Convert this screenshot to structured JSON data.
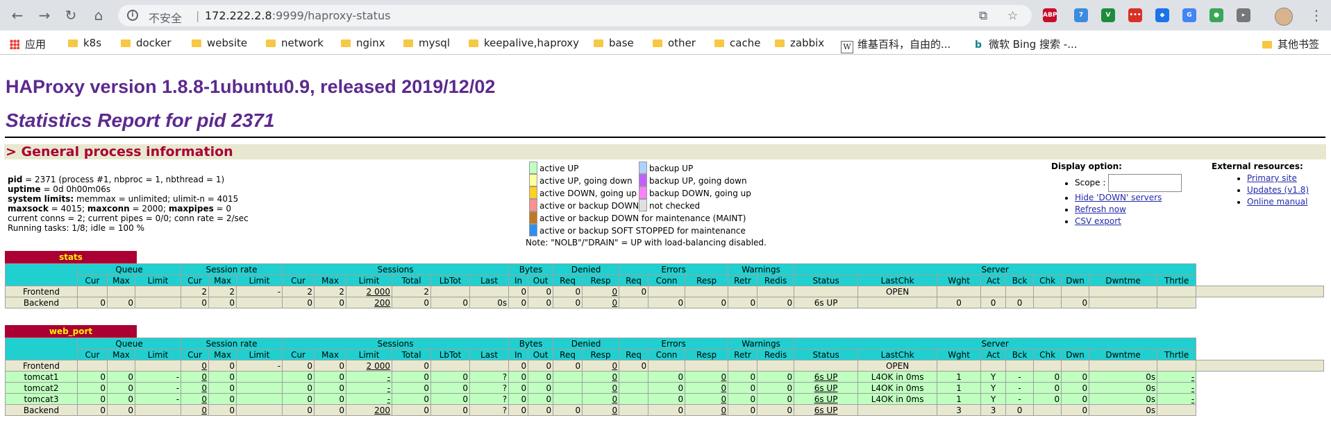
{
  "browser": {
    "insecure_label": "不安全",
    "url_host": "172.222.2.8",
    "url_rest": ":9999/haproxy-status",
    "bookmarks": [
      "应用",
      "k8s",
      "docker",
      "website",
      "network",
      "nginx",
      "mysql",
      "keepalive,haproxy",
      "base",
      "other",
      "cache",
      "zabbix",
      "维基百科，自由的...",
      "微软 Bing 搜索 -...",
      "其他书签"
    ],
    "extensions": [
      {
        "name": "abp-icon",
        "label": "ABP",
        "color": "#c70d2c"
      },
      {
        "name": "puzzle-icon",
        "label": "7",
        "color": "#3c8be0"
      },
      {
        "name": "v-icon",
        "label": "V",
        "color": "#1e8c3a"
      },
      {
        "name": "dots-icon",
        "label": "•••",
        "color": "#d93025"
      },
      {
        "name": "diamond-icon",
        "label": "◆",
        "color": "#1a73e8"
      },
      {
        "name": "translate-icon",
        "label": "G",
        "color": "#4285f4"
      },
      {
        "name": "globe-icon",
        "label": "●",
        "color": "#3aa757"
      },
      {
        "name": "media-icon",
        "label": "▸",
        "color": "#777777"
      }
    ]
  },
  "page": {
    "title": "HAProxy version 1.8.8-1ubuntu0.9, released 2019/12/02",
    "subtitle": "Statistics Report for pid 2371",
    "section": "> General process information",
    "proc": {
      "line1_b": "pid",
      "line1": " = 2371 (process #1, nbproc = 1, nbthread = 1)",
      "line2_b": "uptime",
      "line2": " = 0d 0h00m06s",
      "line3_b": "system limits:",
      "line3": " memmax = unlimited; ulimit-n = 4015",
      "line4_b1": "maxsock",
      "line4_a": " = 4015; ",
      "line4_b2": "maxconn",
      "line4_c": " = 2000; ",
      "line4_b3": "maxpipes",
      "line4_d": " = 0",
      "line5": "current conns = 2; current pipes = 0/0; conn rate = 2/sec",
      "line6": "Running tasks: 1/8; idle = 100 %"
    },
    "legend_left": [
      {
        "label": "active UP",
        "color": "#c0ffc0"
      },
      {
        "label": "active UP, going down",
        "color": "#ffffa0"
      },
      {
        "label": "active DOWN, going up",
        "color": "#ffd020"
      },
      {
        "label": "active or backup DOWN",
        "color": "#ff9090"
      },
      {
        "label": "active or backup DOWN for maintenance (MAINT)",
        "color": "#c07820"
      },
      {
        "label": "active or backup SOFT STOPPED for maintenance",
        "color": "#3090f0"
      }
    ],
    "legend_right": [
      {
        "label": "backup UP",
        "color": "#b0d0ff"
      },
      {
        "label": "backup UP, going down",
        "color": "#c060ff"
      },
      {
        "label": "backup DOWN, going up",
        "color": "#ff80ff"
      },
      {
        "label": "not checked",
        "color": "#e0e0e0"
      }
    ],
    "legend_note": "Note: \"NOLB\"/\"DRAIN\" = UP with load-balancing disabled.",
    "display_option": {
      "title": "Display option:",
      "scope_label": "Scope :",
      "scope_value": "",
      "links": [
        "Hide 'DOWN' servers",
        "Refresh now",
        "CSV export"
      ]
    },
    "external": {
      "title": "External resources:",
      "links": [
        "Primary site",
        "Updates (v1.8)",
        "Online manual"
      ]
    }
  },
  "tables": {
    "group_headers": [
      "",
      "Queue",
      "Session rate",
      "Sessions",
      "Bytes",
      "Denied",
      "Errors",
      "Warnings",
      "Server"
    ],
    "col_headers": [
      "Cur",
      "Max",
      "Limit",
      "Cur",
      "Max",
      "Limit",
      "Cur",
      "Max",
      "Limit",
      "Total",
      "LbTot",
      "Last",
      "In",
      "Out",
      "Req",
      "Resp",
      "Req",
      "Conn",
      "Resp",
      "Retr",
      "Redis",
      "Status",
      "LastChk",
      "Wght",
      "Act",
      "Bck",
      "Chk",
      "Dwn",
      "Dwntme",
      "Thrtle"
    ],
    "stats": {
      "name": "stats",
      "rows": [
        {
          "kind": "fe",
          "cells": [
            "Frontend",
            "",
            "",
            "",
            "2",
            "2",
            "-",
            "2",
            "2",
            "2 000",
            "2",
            "",
            "",
            "0",
            "0",
            "0",
            "0",
            "0",
            "",
            "",
            "",
            "",
            "",
            "OPEN",
            "",
            "",
            "",
            "",
            "",
            "",
            "",
            ""
          ]
        },
        {
          "kind": "be",
          "cells": [
            "Backend",
            "0",
            "0",
            "",
            "0",
            "0",
            "",
            "0",
            "0",
            "200",
            "0",
            "0",
            "0s",
            "0",
            "0",
            "0",
            "0",
            "",
            "0",
            "0",
            "0",
            "0",
            "6s UP",
            "",
            "0",
            "0",
            "0",
            "",
            "0",
            "",
            ""
          ]
        }
      ]
    },
    "web_port": {
      "name": "web_port",
      "rows": [
        {
          "kind": "fe",
          "cells": [
            "Frontend",
            "",
            "",
            "",
            "0",
            "0",
            "-",
            "0",
            "0",
            "2 000",
            "0",
            "",
            "",
            "0",
            "0",
            "0",
            "0",
            "0",
            "",
            "",
            "",
            "",
            "",
            "OPEN",
            "",
            "",
            "",
            "",
            "",
            "",
            "",
            ""
          ]
        },
        {
          "kind": "up",
          "cells": [
            "tomcat1",
            "0",
            "0",
            "-",
            "0",
            "0",
            "",
            "0",
            "0",
            "-",
            "0",
            "0",
            "?",
            "0",
            "0",
            "",
            "0",
            "",
            "0",
            "0",
            "0",
            "0",
            "6s UP",
            "L4OK in 0ms",
            "1",
            "Y",
            "-",
            "0",
            "0",
            "0s",
            "-"
          ]
        },
        {
          "kind": "up",
          "cells": [
            "tomcat2",
            "0",
            "0",
            "-",
            "0",
            "0",
            "",
            "0",
            "0",
            "-",
            "0",
            "0",
            "?",
            "0",
            "0",
            "",
            "0",
            "",
            "0",
            "0",
            "0",
            "0",
            "6s UP",
            "L4OK in 0ms",
            "1",
            "Y",
            "-",
            "0",
            "0",
            "0s",
            "-"
          ]
        },
        {
          "kind": "up",
          "cells": [
            "tomcat3",
            "0",
            "0",
            "-",
            "0",
            "0",
            "",
            "0",
            "0",
            "-",
            "0",
            "0",
            "?",
            "0",
            "0",
            "",
            "0",
            "",
            "0",
            "0",
            "0",
            "0",
            "6s UP",
            "L4OK in 0ms",
            "1",
            "Y",
            "-",
            "0",
            "0",
            "0s",
            "-"
          ]
        },
        {
          "kind": "be",
          "cells": [
            "Backend",
            "0",
            "0",
            "",
            "0",
            "0",
            "",
            "0",
            "0",
            "200",
            "0",
            "0",
            "?",
            "0",
            "0",
            "0",
            "0",
            "",
            "0",
            "0",
            "0",
            "0",
            "6s UP",
            "",
            "3",
            "3",
            "0",
            "",
            "0",
            "0s",
            ""
          ]
        }
      ]
    }
  }
}
